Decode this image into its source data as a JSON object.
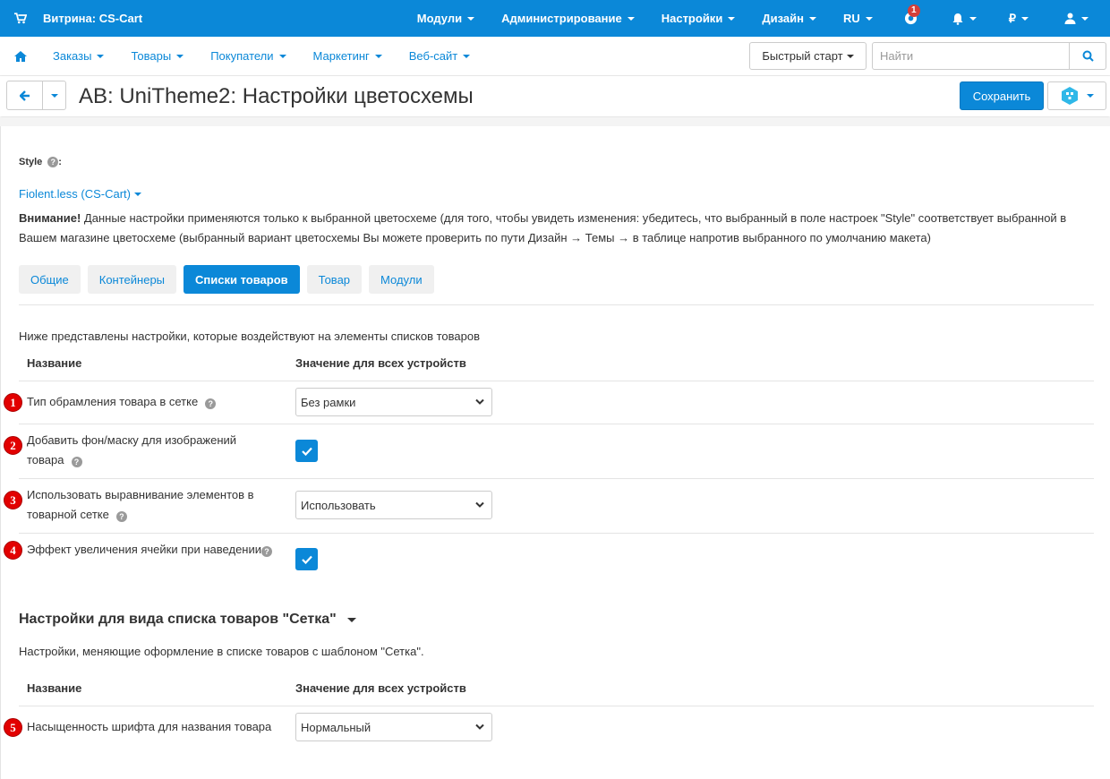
{
  "topbar": {
    "brand": "Витрина: CS-Cart",
    "menu": [
      "Модули",
      "Администрирование",
      "Настройки",
      "Дизайн",
      "RU"
    ],
    "notifications_badge": "1",
    "currency": "₽",
    "colors": {
      "primary": "#0b88d8",
      "badge": "#d43f3a"
    }
  },
  "subnav": {
    "items": [
      "Заказы",
      "Товары",
      "Покупатели",
      "Маркетинг",
      "Веб-сайт"
    ],
    "quick_start": "Быстрый старт",
    "search_placeholder": "Найти"
  },
  "titlebar": {
    "title": "AB: UniTheme2: Настройки цветосхемы",
    "save_label": "Сохранить"
  },
  "content": {
    "style_label": "Style",
    "style_value": "Fiolent.less (CS-Cart)",
    "warning_bold": "Внимание!",
    "warning_text": " Данные настройки применяются только к выбранной цветосхеме (для того, чтобы увидеть изменения: убедитесь, что выбранный в поле настроек \"Style\" соответствует выбранной в Вашем магазине цветосхеме (выбранный вариант цветосхемы Вы можете проверить по пути Дизайн → Темы → в таблице напротив выбранного по умолчанию макета)",
    "tabs": [
      {
        "label": "Общие",
        "active": false
      },
      {
        "label": "Контейнеры",
        "active": false
      },
      {
        "label": "Списки товаров",
        "active": true
      },
      {
        "label": "Товар",
        "active": false
      },
      {
        "label": "Модули",
        "active": false
      }
    ],
    "description": "Ниже представлены настройки, которые воздействуют на элементы списков товаров",
    "col_name": "Название",
    "col_value": "Значение для всех устройств",
    "settings": [
      {
        "num": "1",
        "label": "Тип обрамления товара в сетке",
        "type": "select",
        "value": "Без рамки"
      },
      {
        "num": "2",
        "label": "Добавить фон/маску для изображений товара",
        "type": "checkbox",
        "checked": true
      },
      {
        "num": "3",
        "label": "Использовать выравнивание элементов в товарной сетке",
        "type": "select",
        "value": "Использовать"
      },
      {
        "num": "4",
        "label": "Эффект увеличения ячейки при наведении",
        "type": "checkbox",
        "checked": true
      }
    ],
    "section2_title": "Настройки для вида списка товаров \"Сетка\"",
    "section2_description": "Настройки, меняющие оформление в списке товаров с шаблоном \"Сетка\".",
    "section2_col_name": "Название",
    "section2_col_value": "Значение для всех устройств",
    "section2_settings": [
      {
        "num": "5",
        "label": "Насыщенность шрифта для названия товара",
        "type": "select",
        "value": "Нормальный"
      }
    ]
  }
}
